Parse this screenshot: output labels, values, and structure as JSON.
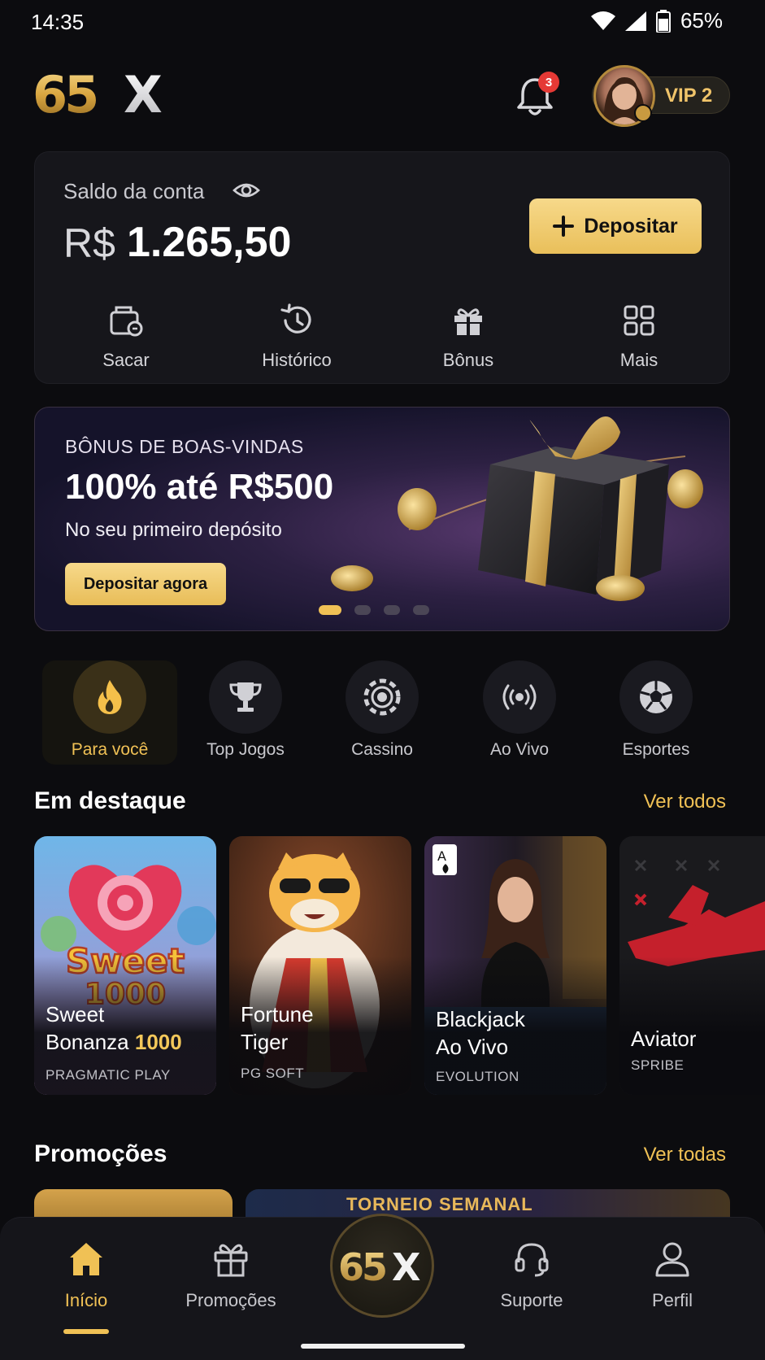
{
  "status_bar": {
    "time": "14:35",
    "battery": "65%"
  },
  "header": {
    "notifications_count": "3",
    "vip_label": "VIP 2"
  },
  "balance": {
    "label": "Saldo da conta",
    "currency": "R$",
    "amount": "1.265,50",
    "deposit_label": "Depositar",
    "actions": [
      {
        "label": "Sacar",
        "icon": "wallet-icon"
      },
      {
        "label": "Histórico",
        "icon": "history-icon"
      },
      {
        "label": "Bônus",
        "icon": "gift-icon"
      },
      {
        "label": "Mais",
        "icon": "grid-icon"
      }
    ]
  },
  "banner": {
    "kicker": "BÔNUS DE BOAS-VINDAS",
    "title": "100% até R$500",
    "subtitle": "No seu primeiro depósito",
    "cta": "Depositar agora",
    "slide_count": 4,
    "active_slide": 1
  },
  "categories": [
    {
      "label": "Para você",
      "icon": "fire-icon",
      "active": true
    },
    {
      "label": "Top Jogos",
      "icon": "trophy-icon",
      "active": false
    },
    {
      "label": "Cassino",
      "icon": "casino-chip-icon",
      "active": false
    },
    {
      "label": "Ao Vivo",
      "icon": "live-broadcast-icon",
      "active": false
    },
    {
      "label": "Esportes",
      "icon": "soccer-ball-icon",
      "active": false
    }
  ],
  "featured": {
    "title": "Em destaque",
    "see_all": "Ver todos",
    "games": [
      {
        "title_line1": "Sweet",
        "title_line2a": "Bonanza ",
        "title_line2b": "1000",
        "provider": "PRAGMATIC PLAY"
      },
      {
        "title_line1": "Fortune",
        "title_line2": "Tiger",
        "provider": "PG SOFT"
      },
      {
        "title_line1": "Blackjack",
        "title_line2": "Ao Vivo",
        "provider": "EVOLUTION"
      },
      {
        "title_line1": "Aviator",
        "provider": "SPRIBE"
      }
    ]
  },
  "promotions": {
    "title": "Promoções",
    "see_all": "Ver todas",
    "promo2_text": "TORNEIO SEMANAL"
  },
  "bottom_nav": [
    {
      "label": "Início",
      "icon": "home-icon",
      "active": true
    },
    {
      "label": "Promoções",
      "icon": "gift-icon",
      "active": false
    },
    {
      "label": "Suporte",
      "icon": "headset-icon",
      "active": false
    },
    {
      "label": "Perfil",
      "icon": "user-icon",
      "active": false
    }
  ],
  "colors": {
    "accent": "#f0c155",
    "background": "#0c0c0f",
    "card": "#16161b",
    "badge": "#e53935"
  }
}
